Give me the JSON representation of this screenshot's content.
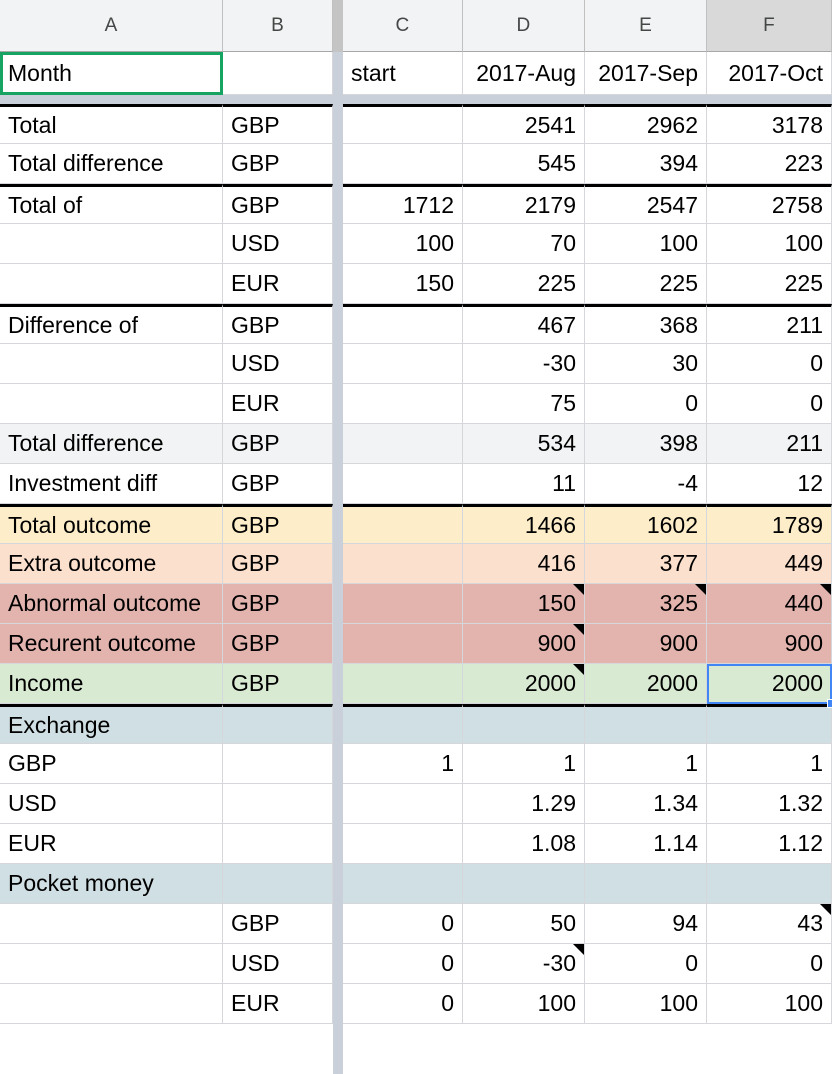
{
  "app": "spreadsheet",
  "columns": [
    {
      "id": "A",
      "label": "A",
      "selected": false
    },
    {
      "id": "B",
      "label": "B",
      "selected": false
    },
    {
      "id": "C",
      "label": "C",
      "selected": false
    },
    {
      "id": "D",
      "label": "D",
      "selected": false
    },
    {
      "id": "E",
      "label": "E",
      "selected": false
    },
    {
      "id": "F",
      "label": "F",
      "selected": true
    }
  ],
  "selection": {
    "header_cell": "Month",
    "header_cell_ref": "A1",
    "header_cell_border_color": "#17a463",
    "active_cell_ref": "F16",
    "active_cell_value": "2000",
    "active_cell_border_color": "#4285f4"
  },
  "colors": {
    "header_bg": "#f1f3f4",
    "header_bg_selected": "#d9d9d9",
    "frozen_divider": "#c9d0da",
    "grid_line": "#d5d7da",
    "row_gray": "#f1f3f4",
    "row_yellow": "#fdeec9",
    "row_peach": "#fbe0cd",
    "row_rose": "#e3b4ae",
    "row_green": "#d9ead3",
    "row_bluegray": "#d0dfe3"
  },
  "rows": [
    {
      "ref": "1",
      "fill": "#ffffff",
      "thick_top": false,
      "cells": {
        "A": {
          "v": "Month",
          "align": "left"
        },
        "B": {
          "v": "",
          "align": "left"
        },
        "C": {
          "v": "start",
          "align": "left"
        },
        "D": {
          "v": "2017-Aug",
          "align": "right"
        },
        "E": {
          "v": "2017-Sep",
          "align": "right"
        },
        "F": {
          "v": "2017-Oct",
          "align": "right"
        }
      }
    },
    {
      "ref": "2",
      "fill": "#ffffff",
      "thick_top": true,
      "cells": {
        "A": {
          "v": "Total",
          "align": "left"
        },
        "B": {
          "v": "GBP",
          "align": "left"
        },
        "C": {
          "v": "",
          "align": "right"
        },
        "D": {
          "v": "2541",
          "align": "right"
        },
        "E": {
          "v": "2962",
          "align": "right"
        },
        "F": {
          "v": "3178",
          "align": "right"
        }
      }
    },
    {
      "ref": "3",
      "fill": "#ffffff",
      "thick_top": false,
      "cells": {
        "A": {
          "v": "Total difference",
          "align": "left"
        },
        "B": {
          "v": "GBP",
          "align": "left"
        },
        "C": {
          "v": "",
          "align": "right"
        },
        "D": {
          "v": "545",
          "align": "right"
        },
        "E": {
          "v": "394",
          "align": "right"
        },
        "F": {
          "v": "223",
          "align": "right"
        }
      }
    },
    {
      "ref": "4",
      "fill": "#ffffff",
      "thick_top": true,
      "cells": {
        "A": {
          "v": "Total of",
          "align": "left"
        },
        "B": {
          "v": "GBP",
          "align": "left"
        },
        "C": {
          "v": "1712",
          "align": "right"
        },
        "D": {
          "v": "2179",
          "align": "right"
        },
        "E": {
          "v": "2547",
          "align": "right"
        },
        "F": {
          "v": "2758",
          "align": "right"
        }
      }
    },
    {
      "ref": "5",
      "fill": "#ffffff",
      "thick_top": false,
      "cells": {
        "A": {
          "v": "",
          "align": "left"
        },
        "B": {
          "v": "USD",
          "align": "left"
        },
        "C": {
          "v": "100",
          "align": "right"
        },
        "D": {
          "v": "70",
          "align": "right"
        },
        "E": {
          "v": "100",
          "align": "right"
        },
        "F": {
          "v": "100",
          "align": "right"
        }
      }
    },
    {
      "ref": "6",
      "fill": "#ffffff",
      "thick_top": false,
      "cells": {
        "A": {
          "v": "",
          "align": "left"
        },
        "B": {
          "v": "EUR",
          "align": "left"
        },
        "C": {
          "v": "150",
          "align": "right"
        },
        "D": {
          "v": "225",
          "align": "right"
        },
        "E": {
          "v": "225",
          "align": "right"
        },
        "F": {
          "v": "225",
          "align": "right"
        }
      }
    },
    {
      "ref": "7",
      "fill": "#ffffff",
      "thick_top": true,
      "cells": {
        "A": {
          "v": "Difference of",
          "align": "left"
        },
        "B": {
          "v": "GBP",
          "align": "left"
        },
        "C": {
          "v": "",
          "align": "right"
        },
        "D": {
          "v": "467",
          "align": "right"
        },
        "E": {
          "v": "368",
          "align": "right"
        },
        "F": {
          "v": "211",
          "align": "right"
        }
      }
    },
    {
      "ref": "8",
      "fill": "#ffffff",
      "thick_top": false,
      "cells": {
        "A": {
          "v": "",
          "align": "left"
        },
        "B": {
          "v": "USD",
          "align": "left"
        },
        "C": {
          "v": "",
          "align": "right"
        },
        "D": {
          "v": "-30",
          "align": "right"
        },
        "E": {
          "v": "30",
          "align": "right"
        },
        "F": {
          "v": "0",
          "align": "right"
        }
      }
    },
    {
      "ref": "9",
      "fill": "#ffffff",
      "thick_top": false,
      "cells": {
        "A": {
          "v": "",
          "align": "left"
        },
        "B": {
          "v": "EUR",
          "align": "left"
        },
        "C": {
          "v": "",
          "align": "right"
        },
        "D": {
          "v": "75",
          "align": "right"
        },
        "E": {
          "v": "0",
          "align": "right"
        },
        "F": {
          "v": "0",
          "align": "right"
        }
      }
    },
    {
      "ref": "10",
      "fill": "#f1f3f4",
      "thick_top": false,
      "cells": {
        "A": {
          "v": "Total difference",
          "align": "left"
        },
        "B": {
          "v": "GBP",
          "align": "left"
        },
        "C": {
          "v": "",
          "align": "right"
        },
        "D": {
          "v": "534",
          "align": "right"
        },
        "E": {
          "v": "398",
          "align": "right"
        },
        "F": {
          "v": "211",
          "align": "right"
        }
      }
    },
    {
      "ref": "11",
      "fill": "#ffffff",
      "thick_top": false,
      "cells": {
        "A": {
          "v": "Investment diff",
          "align": "left"
        },
        "B": {
          "v": "GBP",
          "align": "left"
        },
        "C": {
          "v": "",
          "align": "right"
        },
        "D": {
          "v": "11",
          "align": "right"
        },
        "E": {
          "v": "-4",
          "align": "right"
        },
        "F": {
          "v": "12",
          "align": "right"
        }
      }
    },
    {
      "ref": "12",
      "fill": "#fdeec9",
      "thick_top": true,
      "cells": {
        "A": {
          "v": "Total outcome",
          "align": "left"
        },
        "B": {
          "v": "GBP",
          "align": "left"
        },
        "C": {
          "v": "",
          "align": "right"
        },
        "D": {
          "v": "1466",
          "align": "right"
        },
        "E": {
          "v": "1602",
          "align": "right"
        },
        "F": {
          "v": "1789",
          "align": "right"
        }
      }
    },
    {
      "ref": "13",
      "fill": "#fbe0cd",
      "thick_top": false,
      "cells": {
        "A": {
          "v": "Extra outcome",
          "align": "left"
        },
        "B": {
          "v": "GBP",
          "align": "left"
        },
        "C": {
          "v": "",
          "align": "right"
        },
        "D": {
          "v": "416",
          "align": "right"
        },
        "E": {
          "v": "377",
          "align": "right"
        },
        "F": {
          "v": "449",
          "align": "right"
        }
      }
    },
    {
      "ref": "14",
      "fill": "#e3b4ae",
      "thick_top": false,
      "cells": {
        "A": {
          "v": "Abnormal outcome",
          "align": "left"
        },
        "B": {
          "v": "GBP",
          "align": "left"
        },
        "C": {
          "v": "",
          "align": "right"
        },
        "D": {
          "v": "150",
          "align": "right",
          "note": true
        },
        "E": {
          "v": "325",
          "align": "right",
          "note": true
        },
        "F": {
          "v": "440",
          "align": "right",
          "note": true
        }
      }
    },
    {
      "ref": "15",
      "fill": "#e3b4ae",
      "thick_top": false,
      "cells": {
        "A": {
          "v": "Recurent outcome",
          "align": "left"
        },
        "B": {
          "v": "GBP",
          "align": "left"
        },
        "C": {
          "v": "",
          "align": "right"
        },
        "D": {
          "v": "900",
          "align": "right",
          "note": true
        },
        "E": {
          "v": "900",
          "align": "right"
        },
        "F": {
          "v": "900",
          "align": "right"
        }
      }
    },
    {
      "ref": "16",
      "fill": "#d9ead3",
      "thick_top": false,
      "cells": {
        "A": {
          "v": "Income",
          "align": "left"
        },
        "B": {
          "v": "GBP",
          "align": "left"
        },
        "C": {
          "v": "",
          "align": "right"
        },
        "D": {
          "v": "2000",
          "align": "right",
          "note": true
        },
        "E": {
          "v": "2000",
          "align": "right"
        },
        "F": {
          "v": "2000",
          "align": "right"
        }
      }
    },
    {
      "ref": "17",
      "fill": "#d0dfe3",
      "thick_top": true,
      "cells": {
        "A": {
          "v": "Exchange",
          "align": "left"
        },
        "B": {
          "v": "",
          "align": "left"
        },
        "C": {
          "v": "",
          "align": "right"
        },
        "D": {
          "v": "",
          "align": "right"
        },
        "E": {
          "v": "",
          "align": "right"
        },
        "F": {
          "v": "",
          "align": "right"
        }
      }
    },
    {
      "ref": "18",
      "fill": "#ffffff",
      "thick_top": false,
      "cells": {
        "A": {
          "v": "GBP",
          "align": "left"
        },
        "B": {
          "v": "",
          "align": "left"
        },
        "C": {
          "v": "1",
          "align": "right"
        },
        "D": {
          "v": "1",
          "align": "right"
        },
        "E": {
          "v": "1",
          "align": "right"
        },
        "F": {
          "v": "1",
          "align": "right"
        }
      }
    },
    {
      "ref": "19",
      "fill": "#ffffff",
      "thick_top": false,
      "cells": {
        "A": {
          "v": "USD",
          "align": "left"
        },
        "B": {
          "v": "",
          "align": "left"
        },
        "C": {
          "v": "",
          "align": "right"
        },
        "D": {
          "v": "1.29",
          "align": "right"
        },
        "E": {
          "v": "1.34",
          "align": "right"
        },
        "F": {
          "v": "1.32",
          "align": "right"
        }
      }
    },
    {
      "ref": "20",
      "fill": "#ffffff",
      "thick_top": false,
      "cells": {
        "A": {
          "v": "EUR",
          "align": "left"
        },
        "B": {
          "v": "",
          "align": "left"
        },
        "C": {
          "v": "",
          "align": "right"
        },
        "D": {
          "v": "1.08",
          "align": "right"
        },
        "E": {
          "v": "1.14",
          "align": "right"
        },
        "F": {
          "v": "1.12",
          "align": "right"
        }
      }
    },
    {
      "ref": "21",
      "fill": "#d0dfe3",
      "thick_top": false,
      "cells": {
        "A": {
          "v": "Pocket money",
          "align": "left"
        },
        "B": {
          "v": "",
          "align": "left"
        },
        "C": {
          "v": "",
          "align": "right"
        },
        "D": {
          "v": "",
          "align": "right"
        },
        "E": {
          "v": "",
          "align": "right"
        },
        "F": {
          "v": "",
          "align": "right"
        }
      }
    },
    {
      "ref": "22",
      "fill": "#ffffff",
      "thick_top": false,
      "cells": {
        "A": {
          "v": "",
          "align": "left"
        },
        "B": {
          "v": "GBP",
          "align": "left"
        },
        "C": {
          "v": "0",
          "align": "right"
        },
        "D": {
          "v": "50",
          "align": "right"
        },
        "E": {
          "v": "94",
          "align": "right"
        },
        "F": {
          "v": "43",
          "align": "right",
          "note": true
        }
      }
    },
    {
      "ref": "23",
      "fill": "#ffffff",
      "thick_top": false,
      "cells": {
        "A": {
          "v": "",
          "align": "left"
        },
        "B": {
          "v": "USD",
          "align": "left"
        },
        "C": {
          "v": "0",
          "align": "right"
        },
        "D": {
          "v": "-30",
          "align": "right",
          "note": true
        },
        "E": {
          "v": "0",
          "align": "right"
        },
        "F": {
          "v": "0",
          "align": "right"
        }
      }
    },
    {
      "ref": "24",
      "fill": "#ffffff",
      "thick_top": false,
      "cells": {
        "A": {
          "v": "",
          "align": "left"
        },
        "B": {
          "v": "EUR",
          "align": "left"
        },
        "C": {
          "v": "0",
          "align": "right"
        },
        "D": {
          "v": "100",
          "align": "right"
        },
        "E": {
          "v": "100",
          "align": "right"
        },
        "F": {
          "v": "100",
          "align": "right"
        }
      }
    }
  ]
}
